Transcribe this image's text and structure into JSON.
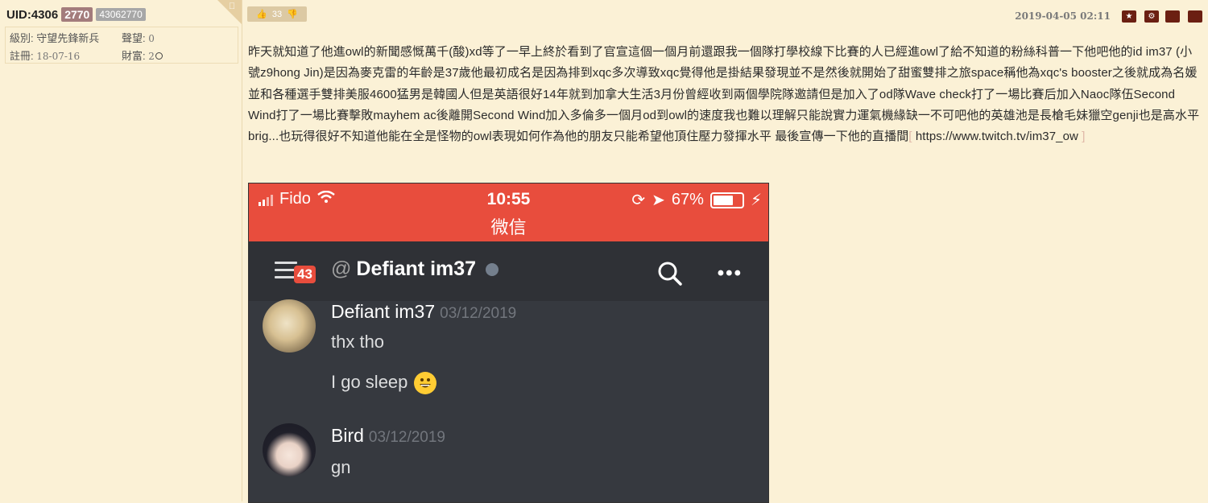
{
  "user": {
    "uid_label": "UID:4306",
    "badge_level": "2770",
    "badge_id": "43062770",
    "level_label": "級別:",
    "level_value": "守望先鋒新兵",
    "prestige_label": "聲望:",
    "prestige_value": "0",
    "register_label": "註冊:",
    "register_value": "18-07-16",
    "wealth_label": "財富:",
    "wealth_value": "2"
  },
  "post": {
    "likes": "33",
    "timestamp": "2019-04-05 02:11",
    "body": "昨天就知道了他進owl的新聞感慨萬千(酸)xd等了一早上終於看到了官宣這個一個月前還跟我一個隊打學校線下比賽的人已經進owl了給不知道的粉絲科普一下他吧他的id im37 (小號z9hong Jin)是因為麥克雷的年齡是37歲他最初成名是因為排到xqc多次導致xqc覺得他是掛結果發現並不是然後就開始了甜蜜雙排之旅space稱他為xqc's booster之後就成為名媛並和各種選手雙排美服4600猛男是韓國人但是英語很好14年就到加拿大生活3月份曾經收到兩個學院隊邀請但是加入了od隊Wave check打了一場比賽后加入Naoc隊伍Second Wind打了一場比賽擊敗mayhem ac後離開Second Wind加入多倫多一個月od到owl的速度我也難以理解只能說實力運氣機緣缺一不可吧他的英雄池是長槍毛妹獵空genji也是高水平brig...也玩得很好不知道他能在全是怪物的owl表現如何作為他的朋友只能希望他頂住壓力發揮水平 最後宣傳一下他的直播間",
    "link_open": "[",
    "link": "https://www.twitch.tv/im37_ow",
    "link_close": "]"
  },
  "screenshot": {
    "carrier": "Fido",
    "time": "10:55",
    "app_label": "微信",
    "battery": "67%",
    "unread_count": "43",
    "channel_at": "@",
    "channel_name": "Defiant im37",
    "messages": [
      {
        "author": "Defiant im37",
        "date": "03/12/2019",
        "lines": [
          "thx tho",
          "I go sleep"
        ]
      },
      {
        "author": "Bird",
        "date": "03/12/2019",
        "lines": [
          "gn"
        ]
      }
    ]
  }
}
